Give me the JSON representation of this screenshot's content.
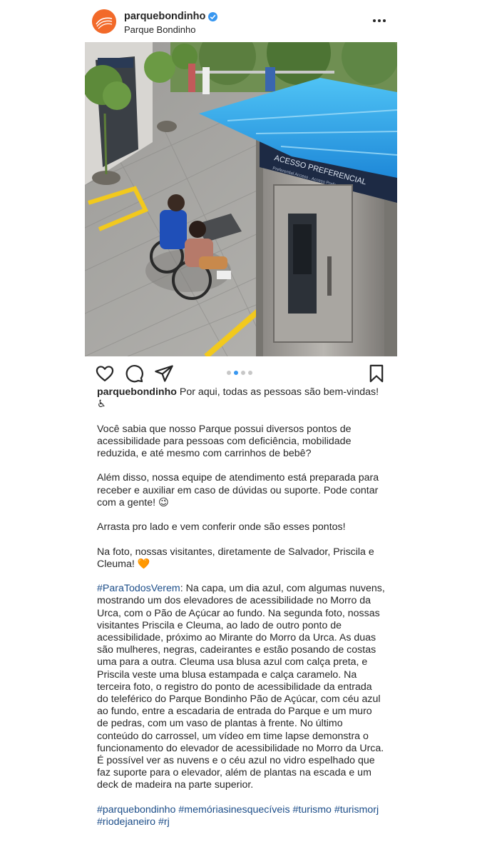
{
  "post": {
    "username": "parquebondinho",
    "location": "Parque Bondinho",
    "verified": true,
    "image_alt_text": "",
    "signage": {
      "line1": "ACESSO PREFERENCIAL",
      "line2": "Preferential Access · Acceso Preferencial"
    }
  },
  "carousel": {
    "count": 4,
    "active_index": 1
  },
  "caption": {
    "username": "parquebondinho",
    "first_line": " Por aqui, todas as pessoas são bem-vindas! ♿",
    "p1": "Você sabia que nosso Parque possui diversos pontos de acessibilidade para pessoas com deficiência, mobilidade reduzida, e até mesmo com carrinhos de bebê?",
    "p2": "Além disso, nossa equipe de atendimento está preparada para receber e auxiliar em caso de dúvidas ou suporte. Pode contar com a gente! 😉",
    "p3": "Arrasta pro lado e vem conferir onde são esses pontos!",
    "p4": "Na foto, nossas visitantes, diretamente de Salvador, Priscila e Cleuma! 🧡",
    "p5_tag": "#ParaTodosVerem",
    "p5_text": ": Na capa, um dia azul, com algumas nuvens, mostrando um dos elevadores de acessibilidade no Morro da Urca, com o Pão de Açúcar ao fundo. Na segunda foto, nossas visitantes Priscila e Cleuma, ao lado de outro ponto de acessibilidade, próximo ao Mirante do Morro da Urca. As duas são mulheres, negras, cadeirantes e estão posando de costas uma para a outra. Cleuma usa blusa azul com calça preta, e Priscila veste uma blusa estampada e calça caramelo. Na terceira foto, o registro do ponto de acessibilidade da entrada do teleférico do Parque Bondinho Pão de Açúcar, com céu azul ao fundo, entre a escadaria de entrada do Parque e um muro de pedras, com um vaso de plantas à frente. No último conteúdo do carrossel, um vídeo em time lapse demonstra o funcionamento do elevador de acessibilidade no Morro da Urca. É possível ver as nuvens e o céu azul no vidro espelhado que faz suporte para o elevador, além de plantas na escada e um deck de madeira na parte superior.",
    "hashtags": [
      "#parquebondinho",
      "#memóriasinesquecíveis",
      "#turismo",
      "#turismorj",
      "#riodejaneiro",
      "#rj"
    ]
  },
  "colors": {
    "accent": "#3897f0",
    "hashtag": "#1d4e89",
    "avatar_bg": "#f26a2a"
  }
}
